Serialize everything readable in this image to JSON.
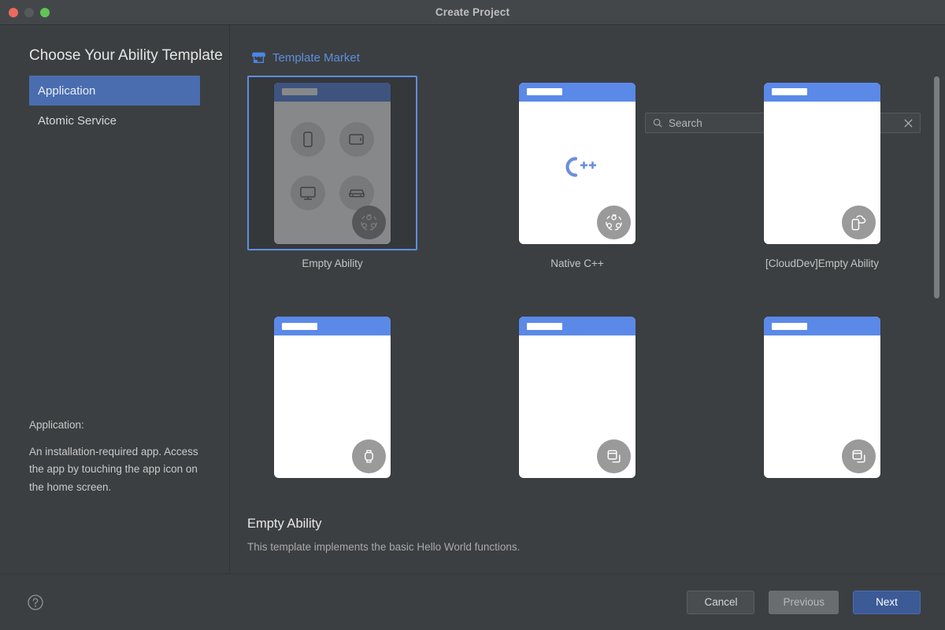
{
  "window": {
    "title": "Create Project",
    "traffic_lights": [
      "close",
      "minimize",
      "zoom"
    ]
  },
  "sidebar": {
    "page_title": "Choose Your Ability Template",
    "items": [
      {
        "label": "Application",
        "selected": true
      },
      {
        "label": "Atomic Service",
        "selected": false
      }
    ],
    "description_title": "Application:",
    "description_body": "An installation-required app. Access the app by touching the app icon on the home screen."
  },
  "market": {
    "link_label": "Template Market",
    "icon": "shop-icon"
  },
  "search": {
    "placeholder": "Search",
    "value": "",
    "icon": "search-icon",
    "clear_icon": "close-icon"
  },
  "templates": [
    {
      "label": "Empty Ability",
      "selected": true,
      "badge": "distributed-icon",
      "thumb": "device-grid"
    },
    {
      "label": "Native C++",
      "selected": false,
      "badge": "distributed-icon",
      "thumb": "cpp-logo"
    },
    {
      "label": "[CloudDev]Empty Ability",
      "selected": false,
      "badge": "cloud-phone-icon",
      "thumb": "blank"
    },
    {
      "label": "",
      "selected": false,
      "badge": "watch-icon",
      "thumb": "blank"
    },
    {
      "label": "",
      "selected": false,
      "badge": "multi-window-icon",
      "thumb": "blank"
    },
    {
      "label": "",
      "selected": false,
      "badge": "multi-window-icon",
      "thumb": "blank"
    }
  ],
  "detail": {
    "title": "Empty Ability",
    "text": "This template implements the basic Hello World functions."
  },
  "footer": {
    "help_icon": "help-circle-icon",
    "cancel_label": "Cancel",
    "previous_label": "Previous",
    "next_label": "Next"
  },
  "colors": {
    "accent_blue": "#5b8fe0",
    "thumb_header_blue": "#5b89e8",
    "selected_item_blue": "#4a6daf",
    "primary_button_blue": "#3c5a96",
    "window_bg": "#3c3f41",
    "titlebar_bg": "#44474a"
  }
}
